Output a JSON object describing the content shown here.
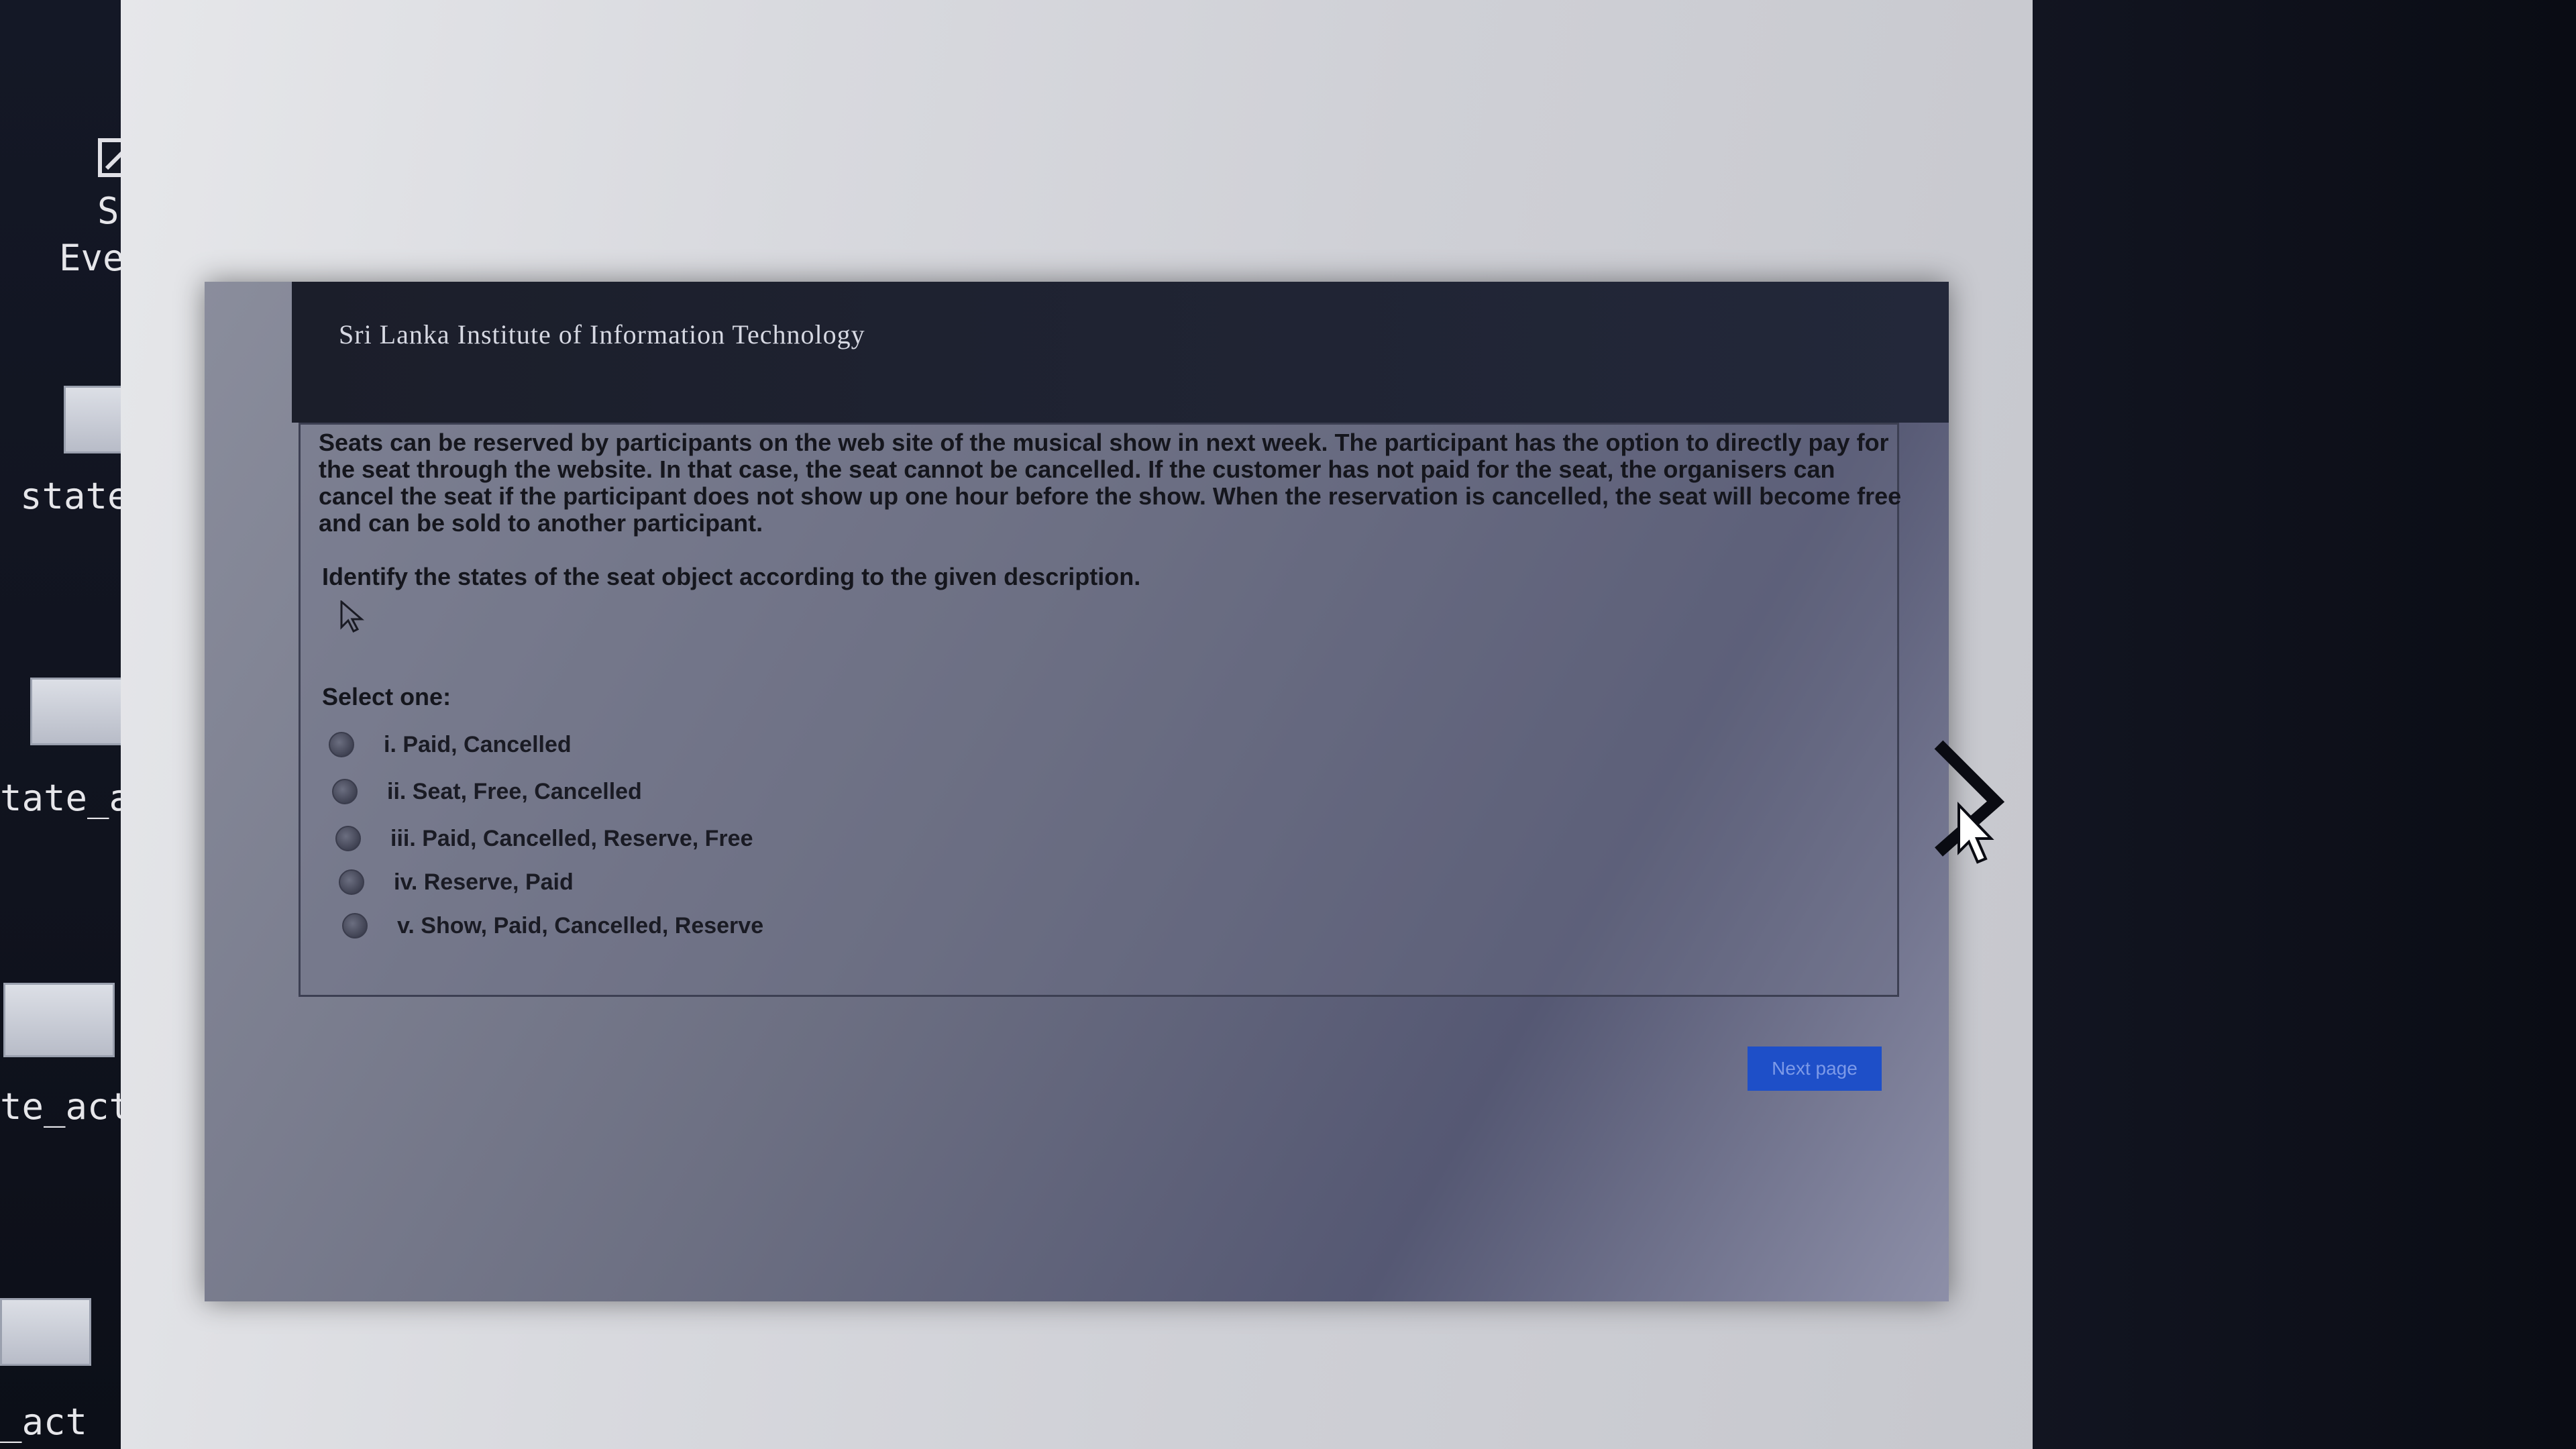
{
  "desktop": {
    "icons": [
      {
        "label_line1": "Search",
        "label_line2": "Everything"
      },
      {
        "label": "state_act"
      },
      {
        "label": "tate_act"
      },
      {
        "label": "te_act"
      },
      {
        "label": "_act"
      }
    ]
  },
  "dialog": {
    "institute": "Sri Lanka Institute of Information Technology",
    "scenario": "Seats can be reserved by participants on the web site of the musical show in next week. The participant has the option to directly pay for the seat through the website. In that case, the seat cannot be cancelled. If the customer has not paid for the seat, the organisers can cancel the seat if the participant does not show up one hour before the show. When the reservation is cancelled, the seat will become free and can be sold to another participant.",
    "instruction": "Identify the states of the seat object according to the given description.",
    "select_label": "Select one:",
    "options": [
      "i. Paid, Cancelled",
      "ii. Seat, Free, Cancelled",
      "iii. Paid, Cancelled, Reserve, Free",
      "iv. Reserve, Paid",
      "v. Show, Paid, Cancelled, Reserve"
    ],
    "next_label": "Next page"
  }
}
